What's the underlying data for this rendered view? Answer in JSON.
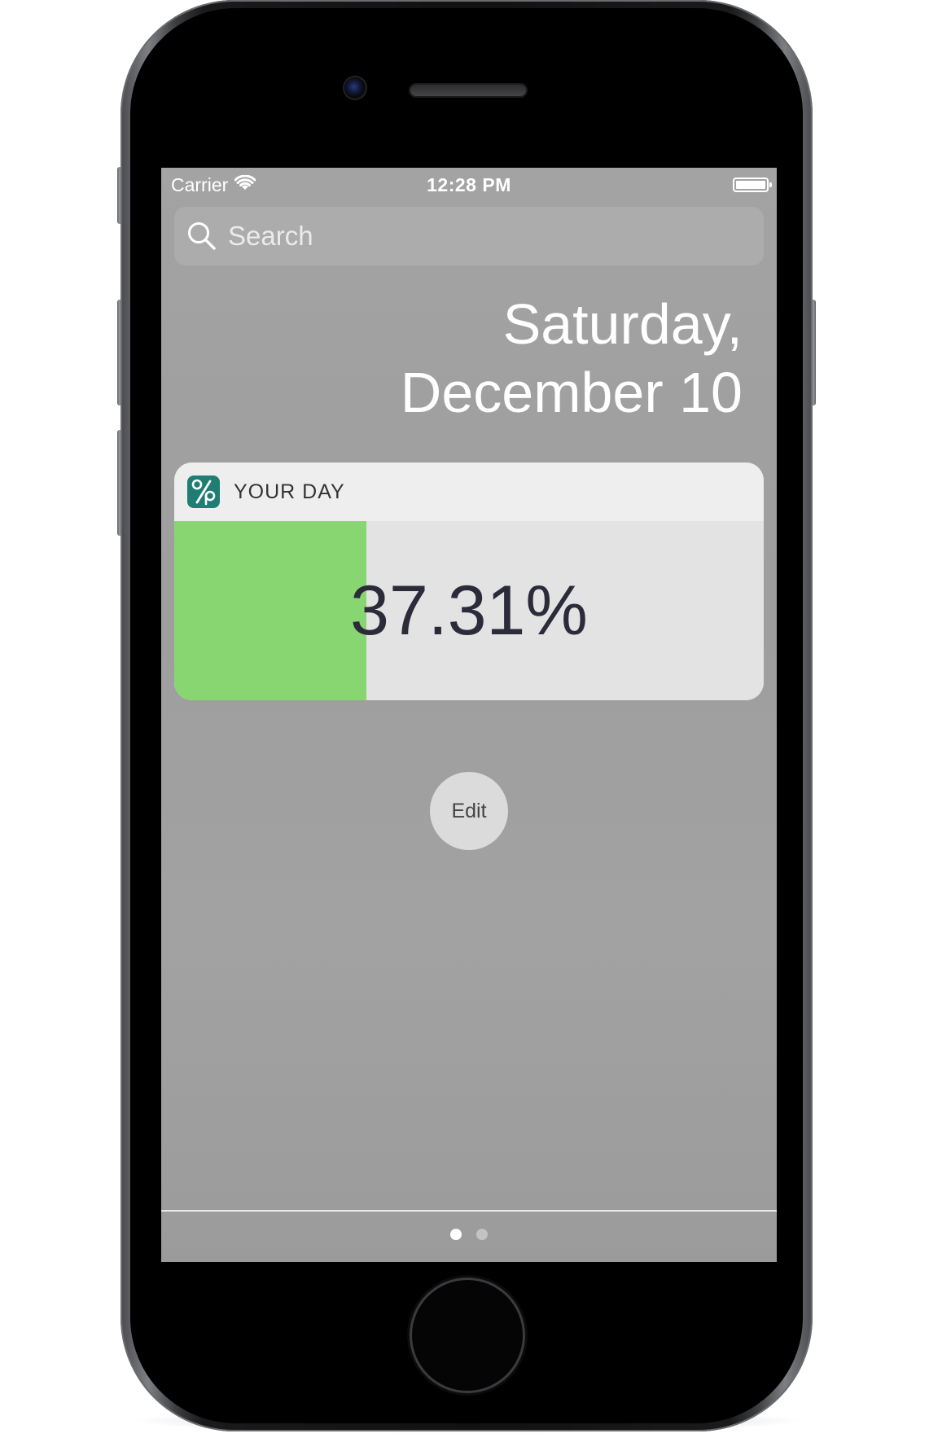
{
  "status_bar": {
    "carrier": "Carrier",
    "time": "12:28 PM",
    "wifi_icon": "wifi-icon",
    "battery_icon": "battery-icon"
  },
  "search": {
    "placeholder": "Search",
    "icon": "search-icon"
  },
  "date": {
    "weekday": "Saturday,",
    "day": "December 10"
  },
  "widget": {
    "title": "YOUR DAY",
    "icon": "percent-app-icon",
    "icon_color": "#1f7d73",
    "progress_label": "37.31%",
    "progress_fraction": 0.3731,
    "fill_color": "#88d672"
  },
  "edit": {
    "label": "Edit"
  },
  "pager": {
    "pages": 2,
    "active_index": 0
  }
}
